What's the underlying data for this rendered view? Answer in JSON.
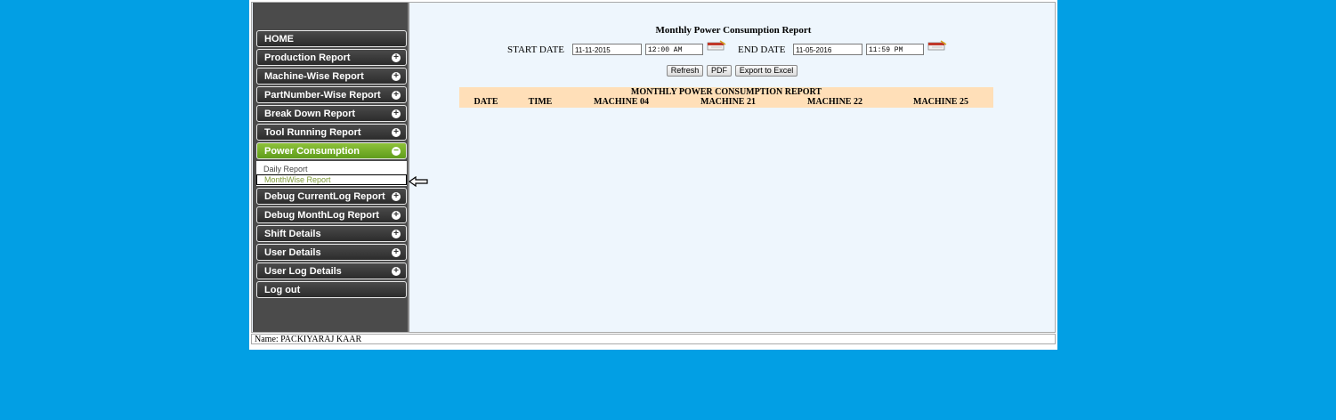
{
  "sidebar": {
    "items": [
      {
        "label": "HOME",
        "icon": ""
      },
      {
        "label": "Production Report",
        "icon": "plus-circle-icon"
      },
      {
        "label": "Machine-Wise Report",
        "icon": "plus-circle-icon"
      },
      {
        "label": "PartNumber-Wise Report",
        "icon": "plus-circle-icon"
      },
      {
        "label": "Break Down Report",
        "icon": "plus-circle-icon"
      },
      {
        "label": "Tool Running Report",
        "icon": "plus-circle-icon"
      },
      {
        "label": "Power Consumption",
        "icon": "minus-circle-icon"
      },
      {
        "label": "Debug CurrentLog Report",
        "icon": "plus-circle-icon"
      },
      {
        "label": "Debug MonthLog Report",
        "icon": "plus-circle-icon"
      },
      {
        "label": "Shift Details",
        "icon": "plus-circle-icon"
      },
      {
        "label": "User Details",
        "icon": "plus-circle-icon"
      },
      {
        "label": "User Log Details",
        "icon": "plus-circle-icon"
      },
      {
        "label": "Log out",
        "icon": ""
      }
    ],
    "submenu": {
      "daily": "Daily Report",
      "monthwise": "MonthWise Report"
    },
    "colors": {
      "background": "#4b4b4b",
      "active": "#7fb32e"
    }
  },
  "main": {
    "title": "Monthly Power Consumption Report",
    "start_label": "START DATE",
    "start_date": "11-11-2015",
    "start_time": "12:00 AM",
    "end_label": "END DATE",
    "end_date": "11-05-2016",
    "end_time": "11:59 PM",
    "buttons": {
      "refresh": "Refresh",
      "pdf": "PDF",
      "excel": "Export to Excel"
    },
    "table": {
      "caption": "MONTHLY POWER CONSUMPTION REPORT",
      "headers": [
        "DATE",
        "TIME",
        "MACHINE 04",
        "MACHINE 21",
        "MACHINE 22",
        "MACHINE 25"
      ],
      "header_color": "#ffdfb8"
    }
  },
  "footer": {
    "name": "Name: PACKIYARAJ KAAR"
  },
  "page_background": "#029fe4"
}
